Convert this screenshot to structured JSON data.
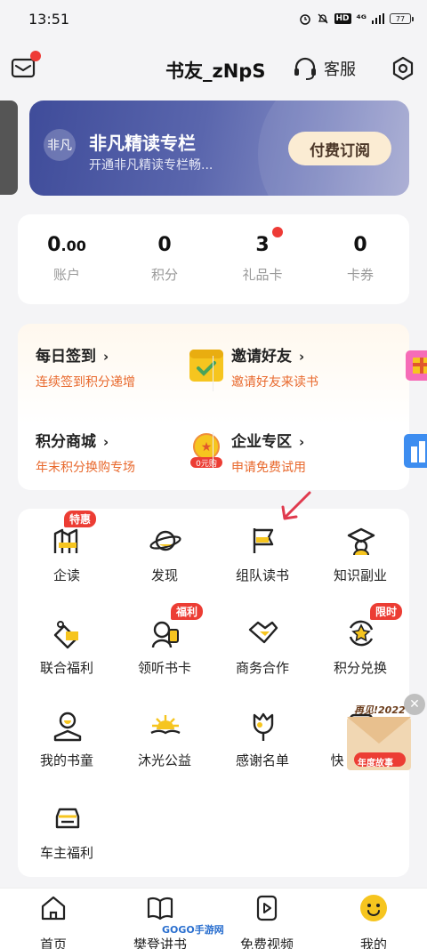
{
  "status_bar": {
    "time": "13:51",
    "network": "⁴ᴳ",
    "hd": "HD",
    "battery": "77"
  },
  "header": {
    "username": "书友_zNpS",
    "service_label": "客服"
  },
  "vip_banner": {
    "logo_text": "非凡",
    "title": "非凡精读专栏",
    "subtitle": "开通非凡精读专栏畅...",
    "button_label": "付费订阅",
    "colors": {
      "start": "#3f4c9a",
      "end": "#a6aad2",
      "button": "#fbecd3"
    }
  },
  "stats": [
    {
      "value": "0",
      "decimal": ".00",
      "label": "账户"
    },
    {
      "value": "0",
      "decimal": "",
      "label": "积分"
    },
    {
      "value": "3",
      "decimal": "",
      "label": "礼品卡",
      "has_dot": true
    },
    {
      "value": "0",
      "decimal": "",
      "label": "卡券"
    }
  ],
  "features": [
    {
      "title": "每日签到",
      "subtitle": "连续签到积分递增",
      "icon": "calendar-check-icon"
    },
    {
      "title": "邀请好友",
      "subtitle": "邀请好友来读书",
      "icon": "gift-box-icon"
    },
    {
      "title": "积分商城",
      "subtitle": "年末积分换购专场",
      "icon": "coin-zero-buy-icon",
      "icon_text": "0元购"
    },
    {
      "title": "企业专区",
      "subtitle": "申请免费试用",
      "icon": "enterprise-building-icon"
    }
  ],
  "grid": [
    {
      "label": "企读",
      "icon": "enterprise-read-icon",
      "badge": "特惠"
    },
    {
      "label": "发现",
      "icon": "planet-icon"
    },
    {
      "label": "组队读书",
      "icon": "team-flag-icon"
    },
    {
      "label": "知识副业",
      "icon": "graduation-cap-icon"
    },
    {
      "label": "联合福利",
      "icon": "hand-gift-icon"
    },
    {
      "label": "领听书卡",
      "icon": "listen-card-icon",
      "badge": "福利"
    },
    {
      "label": "商务合作",
      "icon": "handshake-icon"
    },
    {
      "label": "积分兑换",
      "icon": "star-exchange-icon",
      "badge": "限时"
    },
    {
      "label": "我的书童",
      "icon": "book-boy-icon"
    },
    {
      "label": "沐光公益",
      "icon": "sunrise-book-icon"
    },
    {
      "label": "感谢名单",
      "icon": "flower-icon"
    },
    {
      "label": "快",
      "icon": "quick-icon"
    },
    {
      "label": "车主福利",
      "icon": "car-icon"
    }
  ],
  "float_ad": {
    "top_text": "再见!2022",
    "bottom_text": "年度故事"
  },
  "tabbar": [
    {
      "label": "首页",
      "icon": "home-icon"
    },
    {
      "label": "樊登讲书",
      "icon": "open-book-icon"
    },
    {
      "label": "GOGO手游网",
      "icon": "watermark-logo"
    },
    {
      "label": "免费视频",
      "icon": "play-video-icon"
    },
    {
      "label": "我的",
      "icon": "smiley-avatar-icon"
    }
  ],
  "watermark": "GOGO手游网",
  "accent": {
    "red": "#ec3d34",
    "orange_text": "#e8682c",
    "icon_yellow": "#f6c51f"
  }
}
